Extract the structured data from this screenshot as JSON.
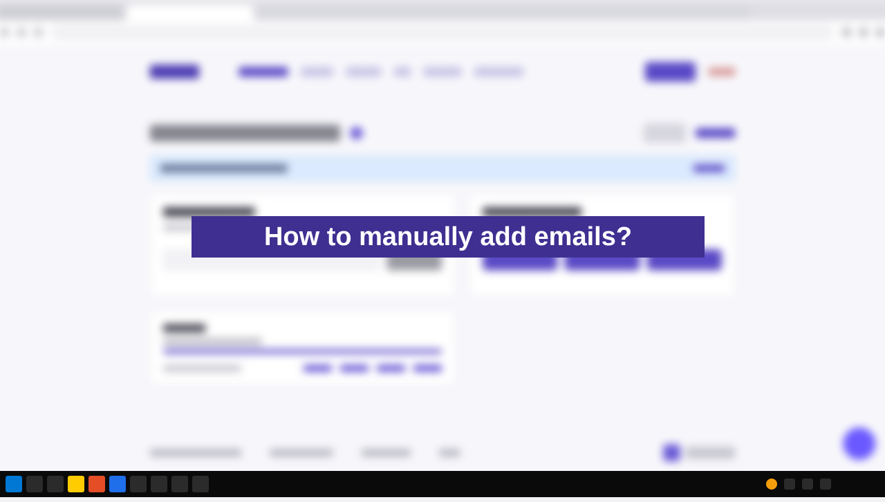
{
  "overlay": {
    "title": "How to manually add emails?"
  }
}
